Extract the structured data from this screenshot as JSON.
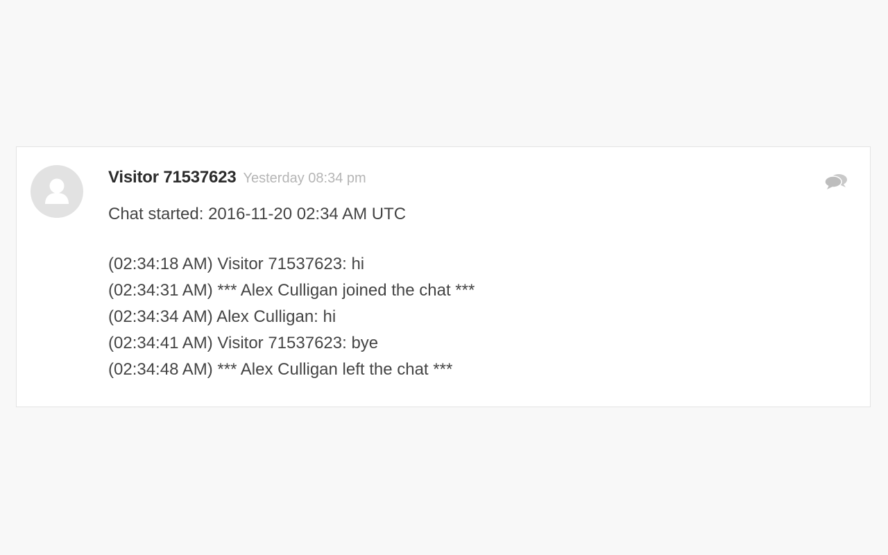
{
  "chat": {
    "visitor_name": "Visitor 71537623",
    "timestamp": "Yesterday 08:34 pm",
    "started": "Chat started: 2016-11-20 02:34 AM UTC",
    "messages": [
      "(02:34:18 AM) Visitor 71537623: hi",
      "(02:34:31 AM) *** Alex Culligan joined the chat ***",
      "(02:34:34 AM) Alex Culligan: hi",
      "(02:34:41 AM) Visitor 71537623: bye",
      "(02:34:48 AM) *** Alex Culligan left the chat ***"
    ]
  },
  "icons": {
    "avatar": "user-avatar-icon",
    "chat_type": "chat-bubbles-icon"
  },
  "colors": {
    "background": "#f8f8f8",
    "card": "#ffffff",
    "name_text": "#2b2b2b",
    "timestamp_text": "#b5b5b5",
    "body_text": "#444444",
    "avatar_bg": "#e2e2e2",
    "icon": "#c4c4c4"
  }
}
